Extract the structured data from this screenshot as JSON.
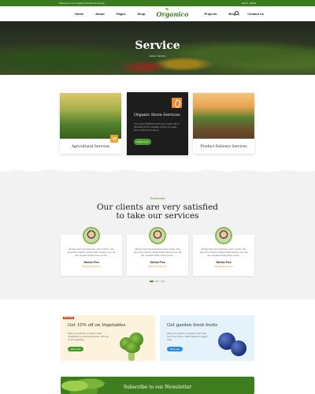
{
  "topbar": {
    "welcome": "Welcome to our Organic WordPress theme!",
    "cart": "Cart 0 - $0.00"
  },
  "nav": {
    "items": [
      "Home",
      "About",
      "Pages",
      "Shop"
    ],
    "items_right": [
      "Projects",
      "Blog",
      "Contact us"
    ],
    "logo": "Organico"
  },
  "hero": {
    "title": "Service",
    "breadcrumb": "Home  /  Service"
  },
  "services": {
    "card1_title": "Agricultural Services",
    "card2_title": "Organic Store Services",
    "card2_text": "It is a long established fact that a reader will be distracted by the readable content of a page when looking at its layout.",
    "card2_button": "Read more",
    "card3_title": "Product Delivery Services"
  },
  "testimonials": {
    "subtitle": "Testimonials",
    "title_line1": "Our clients are very satisfied",
    "title_line2": "to take our services",
    "items": [
      {
        "text": "Simply dummied all lorem ipsum dolor, has been the industry aliquet with random text, all the needed whole lorem ipsum.",
        "name": "Sinira Fox",
        "role": "Managing director"
      },
      {
        "text": "Simply dummied all lorem ipsum dolor, has been the industry aliquet with random text, all the needed whole lorem ipsum.",
        "name": "Sinira Fox",
        "role": "Managing director"
      },
      {
        "text": "Simply dummied all lorem ipsum dolor, has been the industry aliquet with random text, all the needed whole lorem ipsum.",
        "name": "Sinira Fox",
        "role": "Managing director"
      }
    ]
  },
  "promos": {
    "promo1_tag": "BIG SALE",
    "promo1_title": "Get 10% off on Vegetables",
    "promo1_text": "Shop our selection of organic fresh Vegetables in a discounted price, 10% off on all vegetables.",
    "promo1_button": "Shop now",
    "promo2_title": "Get garden fresh fruits",
    "promo2_text": "Shop our selection of organic fresh fruits from Tony Farms, 100% natural & organic fruits.",
    "promo2_button": "Shop now"
  },
  "newsletter": {
    "title": "Subscribe to our Newsletter"
  },
  "colors": {
    "brand_green": "#3b7a1f",
    "accent_orange": "#f08a30",
    "link_blue": "#2f8ad9"
  }
}
